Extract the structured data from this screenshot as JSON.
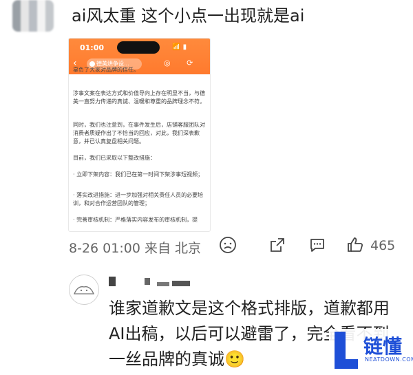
{
  "comment": {
    "title": "ai风太重 这个小点一出现就是ai"
  },
  "phone": {
    "status_time": "01:00",
    "status_icons": "📶 ▮",
    "shop_name": "德美烘争设...",
    "nav_icons": "◎ ⟳ ⋯",
    "paragraphs": [
      "辜负了大家对品牌的信任。",
      "涉事文案在表达方式和价值导向上存在明显不当，与德美一直努力传递的真诚、温暖和尊重的品牌理念不符。",
      "同时，我们也注意到，在事件发生后，店铺客服团队对消费者质疑作出了不恰当的回应，对此，我们深表歉意，并已认真复盘相关问题。",
      "目前，我们已采取以下整改措施：",
      "· 立即下架内容：我们已在第一时间下架涉事短视频；",
      "· 落实改进措施：进一步加强对相关责任人员的必要培训，和对合作运营团队的管理；",
      "· 完善审核机制：严格落实内容发布的审核机制，提"
    ]
  },
  "meta": {
    "time_location": "8-26 01:00 来自 北京",
    "like_count": "465"
  },
  "reply": {
    "text": "谁家道歉文是这个格式排版，道歉都用AI出稿，以后可以避雷了，完全看不到一丝品牌的真诚🙂"
  },
  "watermark": {
    "brand": "链懂",
    "site": "NEATDOWN.COM"
  },
  "colors": {
    "accent_orange": "#ff7a2e",
    "watermark_blue": "#1e4fd7"
  }
}
